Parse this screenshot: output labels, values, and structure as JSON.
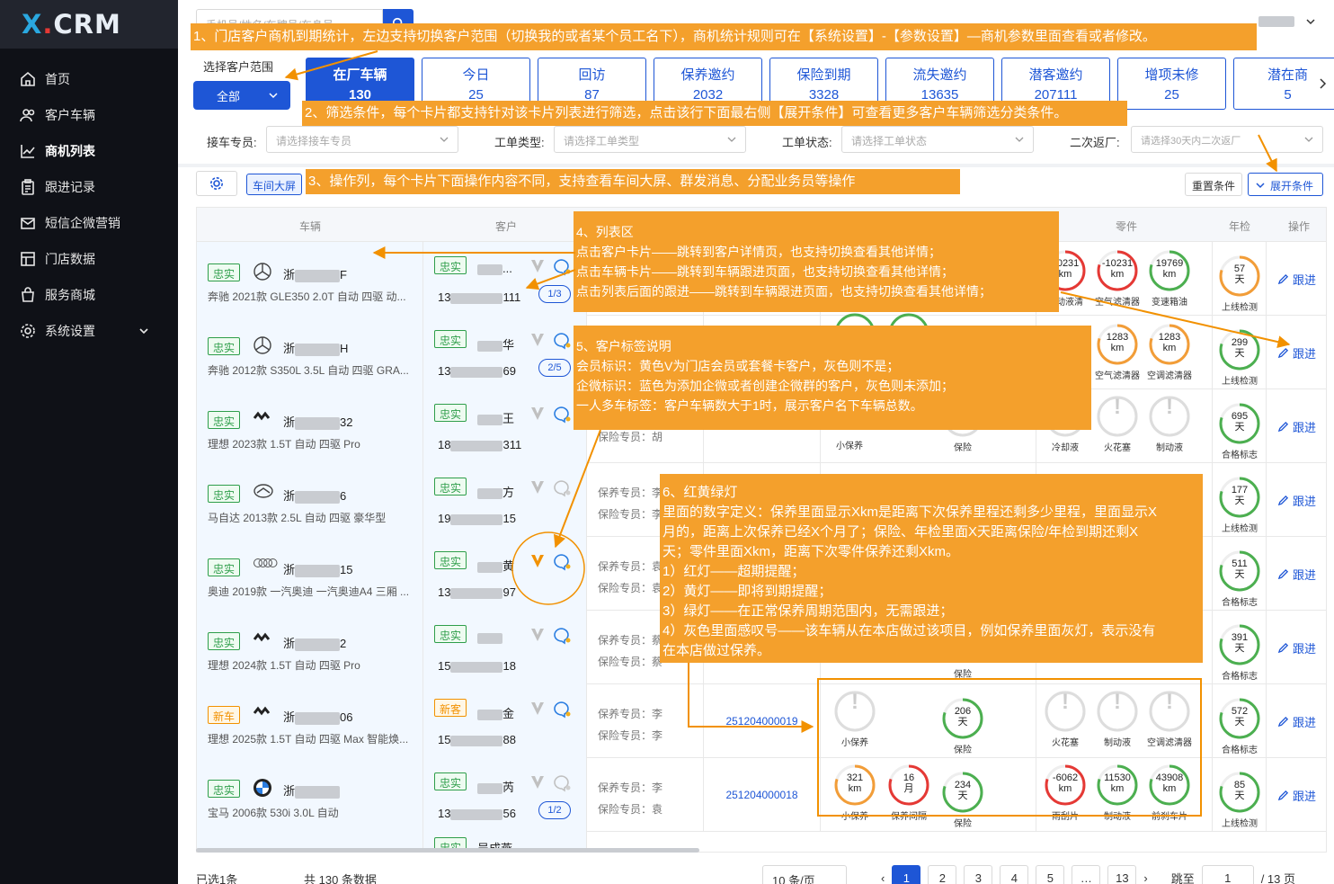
{
  "app": {
    "logo_x": "X",
    "logo_dot": ".",
    "logo_crm": "CRM"
  },
  "sidebar": {
    "items": [
      {
        "label": "首页",
        "icon": "home-icon",
        "active": false
      },
      {
        "label": "客户车辆",
        "icon": "users-icon",
        "active": false
      },
      {
        "label": "商机列表",
        "icon": "chart-line-icon",
        "active": true
      },
      {
        "label": "跟进记录",
        "icon": "clipboard-icon",
        "active": false
      },
      {
        "label": "短信企微营销",
        "icon": "mail-icon",
        "active": false
      },
      {
        "label": "门店数据",
        "icon": "data-board-icon",
        "active": false
      },
      {
        "label": "服务商城",
        "icon": "bag-icon",
        "active": false
      },
      {
        "label": "系统设置",
        "icon": "settings-icon",
        "active": false
      }
    ]
  },
  "topbar": {
    "search_placeholder": "手机号/姓名/车牌号/车身号"
  },
  "scope": {
    "label": "选择客户范围",
    "value": "全部"
  },
  "cards": [
    {
      "title": "在厂车辆",
      "count": "130",
      "active": true
    },
    {
      "title": "今日",
      "count": "25",
      "active": false
    },
    {
      "title": "回访",
      "count": "87",
      "active": false
    },
    {
      "title": "保养邀约",
      "count": "2032",
      "active": false
    },
    {
      "title": "保险到期",
      "count": "3328",
      "active": false
    },
    {
      "title": "流失邀约",
      "count": "13635",
      "active": false
    },
    {
      "title": "潜客邀约",
      "count": "207111",
      "active": false
    },
    {
      "title": "增项未修",
      "count": "25",
      "active": false
    },
    {
      "title": "潜在商",
      "count": "5",
      "active": false
    }
  ],
  "filters": {
    "reception": {
      "label": "接车专员:",
      "placeholder": "请选择接车专员"
    },
    "order_type": {
      "label": "工单类型:",
      "placeholder": "请选择工单类型"
    },
    "order_status": {
      "label": "工单状态:",
      "placeholder": "请选择工单状态"
    },
    "return": {
      "label": "二次返厂:",
      "placeholder": "请选择30天内二次返厂"
    }
  },
  "toolbar": {
    "workshop_screen": "车间大屏",
    "reset": "重置条件",
    "expand": "展开条件"
  },
  "table": {
    "headers": {
      "vehicle": "车辆",
      "customer": "客户",
      "parts": "零件",
      "annual": "年检",
      "op": "操作"
    },
    "rows": [
      {
        "tag": "忠实",
        "tag_color": "g",
        "brand": "benz-logo",
        "plate_prefix": "浙",
        "plate_suffix": "F",
        "model": "奔驰 2021款 GLE350 2.0T 自动 四驱 动...",
        "ctag": "忠实",
        "cname_suffix": "...",
        "phone_prefix": "13",
        "phone_suffix": "111",
        "vip": false,
        "wx": true,
        "count": "1/3",
        "annual_val": "57",
        "annual_unit": "天",
        "annual_label": "上线检测",
        "annual_color": "#f29d38",
        "follow": "跟进"
      },
      {
        "tag": "忠实",
        "tag_color": "g",
        "brand": "benz-logo",
        "plate_prefix": "浙",
        "plate_suffix": "H",
        "model": "奔驰 2012款 S350L 3.5L 自动 四驱 GRA...",
        "ctag": "忠实",
        "cname_suffix": "华",
        "phone_prefix": "13",
        "phone_suffix": "69",
        "vip": false,
        "wx": true,
        "count": "2/5",
        "annual_val": "299",
        "annual_unit": "天",
        "annual_label": "上线检测",
        "annual_color": "#4caf50",
        "follow": "跟进"
      },
      {
        "tag": "忠实",
        "tag_color": "g",
        "brand": "lixiang-logo",
        "plate_prefix": "浙",
        "plate_suffix": "32",
        "model": "理想 2023款 1.5T 自动 四驱 Pro",
        "ctag": "忠实",
        "cname_suffix": "王",
        "phone_prefix": "18",
        "phone_suffix": "311",
        "vip": false,
        "wx": true,
        "count": "",
        "annual_val": "695",
        "annual_unit": "天",
        "annual_label": "合格标志",
        "annual_color": "#4caf50",
        "follow": "跟进"
      },
      {
        "tag": "忠实",
        "tag_color": "g",
        "brand": "mazda-logo",
        "plate_prefix": "浙",
        "plate_suffix": "6",
        "model": "马自达 2013款 2.5L 自动 四驱 豪华型",
        "ctag": "忠实",
        "cname_suffix": "方",
        "phone_prefix": "19",
        "phone_suffix": "15",
        "vip": false,
        "wx": false,
        "count": "",
        "annual_val": "177",
        "annual_unit": "天",
        "annual_label": "上线检测",
        "annual_color": "#4caf50",
        "follow": "跟进"
      },
      {
        "tag": "忠实",
        "tag_color": "g",
        "brand": "audi-logo",
        "plate_prefix": "浙",
        "plate_suffix": "15",
        "model": "奥迪 2019款 一汽奥迪 一汽奥迪A4 三厢 ...",
        "ctag": "忠实",
        "cname_suffix": "黄",
        "phone_prefix": "13",
        "phone_suffix": "97",
        "vip": true,
        "wx": true,
        "count": "",
        "annual_val": "511",
        "annual_unit": "天",
        "annual_label": "合格标志",
        "annual_color": "#4caf50",
        "follow": "跟进"
      },
      {
        "tag": "忠实",
        "tag_color": "g",
        "brand": "lixiang-logo",
        "plate_prefix": "浙",
        "plate_suffix": "2",
        "model": "理想 2024款 1.5T 自动 四驱 Pro",
        "ctag": "忠实",
        "cname_suffix": "",
        "phone_prefix": "15",
        "phone_suffix": "18",
        "vip": false,
        "wx": true,
        "count": "",
        "annual_val": "391",
        "annual_unit": "天",
        "annual_label": "合格标志",
        "annual_color": "#4caf50",
        "follow": "跟进"
      },
      {
        "tag": "新车",
        "tag_color": "o",
        "brand": "lixiang-logo",
        "plate_prefix": "浙",
        "plate_suffix": "06",
        "model": "理想 2025款 1.5T 自动 四驱 Max 智能焕...",
        "ctag": "新客",
        "cname_suffix": "金",
        "phone_prefix": "15",
        "phone_suffix": "88",
        "vip": false,
        "wx": true,
        "count": "",
        "annual_val": "572",
        "annual_unit": "天",
        "annual_label": "合格标志",
        "annual_color": "#4caf50",
        "follow": "跟进"
      },
      {
        "tag": "忠实",
        "tag_color": "g",
        "brand": "bmw-logo",
        "plate_prefix": "浙",
        "plate_suffix": "",
        "model": "宝马 2006款 530i 3.0L 自动",
        "ctag": "忠实",
        "cname_suffix": "芮",
        "phone_prefix": "13",
        "phone_suffix": "56",
        "vip": false,
        "wx": false,
        "count": "1/2",
        "annual_val": "85",
        "annual_unit": "天",
        "annual_label": "上线检测",
        "annual_color": "#4caf50",
        "follow": "跟进"
      }
    ],
    "row1_parts": [
      {
        "val": "10231",
        "unit": "km",
        "label": "制动液清",
        "color": "#e53935"
      },
      {
        "val": "-10231",
        "unit": "km",
        "label": "空气滤清器",
        "color": "#e53935"
      },
      {
        "val": "19769",
        "unit": "km",
        "label": "变速箱油",
        "color": "#4caf50"
      }
    ],
    "row2_parts": [
      {
        "val": "1283",
        "unit": "km",
        "label": "空气滤清器",
        "color": "#f29d38"
      },
      {
        "val": "1283",
        "unit": "km",
        "label": "空调滤清器",
        "color": "#f29d38"
      }
    ],
    "row3": {
      "mnt_label": "小保养",
      "ins_label": "保险",
      "parts": [
        {
          "label": "冷却液"
        },
        {
          "label": "火花塞"
        },
        {
          "label": "制动液"
        }
      ]
    },
    "row3_emp": "保险专员：胡",
    "row4_emp": [
      "保养专员：李",
      "保险专员：李"
    ],
    "row5_emp": [
      "保养专员：袁",
      "保险专员：袁"
    ],
    "row6_emp": [
      "保养专员：蔡",
      "保险专员：蔡"
    ],
    "row6_ins_label": "保险",
    "row7": {
      "emp": [
        "保养专员：李",
        "保险专员：李"
      ],
      "order": "251204000019",
      "mnt_label": "小保养",
      "ins_val": "206",
      "ins_unit": "天",
      "ins_label": "保险",
      "parts": [
        {
          "label": "火花塞"
        },
        {
          "label": "制动液"
        },
        {
          "label": "空调滤清器"
        }
      ]
    },
    "row8": {
      "emp": [
        "保养专员：李",
        "保险专员：袁"
      ],
      "order": "251204000018",
      "mnt": [
        {
          "val": "321",
          "unit": "km",
          "label": "小保养",
          "color": "#f29d38"
        },
        {
          "val": "16",
          "unit": "月",
          "label": "保养间隔",
          "color": "#e53935"
        }
      ],
      "ins_val": "234",
      "ins_unit": "天",
      "ins_label": "保险",
      "parts": [
        {
          "val": "-6062",
          "unit": "km",
          "label": "雨刮片",
          "color": "#e53935"
        },
        {
          "val": "11530",
          "unit": "km",
          "label": "制动液",
          "color": "#4caf50"
        },
        {
          "val": "43908",
          "unit": "km",
          "label": "前刹车片",
          "color": "#4caf50"
        }
      ]
    },
    "row9_tag": "忠实",
    "row9_cname": "吴成燕"
  },
  "footer": {
    "selected": "已选1条",
    "total": "共 130 条数据",
    "page_size": "10 条/页",
    "pages": [
      "1",
      "2",
      "3",
      "4",
      "5",
      "…",
      "13"
    ],
    "jump_label": "跳至",
    "jump_value": "1",
    "page_total": "/ 13 页"
  },
  "annotations": {
    "a1": "1、门店客户商机到期统计，左边支持切换客户范围（切换我的或者某个员工名下），商机统计规则可在【系统设置】-【参数设置】—商机参数里面查看或者修改。",
    "a2": "2、筛选条件，每个卡片都支持针对该卡片列表进行筛选，点击该行下面最右侧【展开条件】可查看更多客户车辆筛选分类条件。",
    "a3": "3、操作列，每个卡片下面操作内容不同，支持查看车间大屏、群发消息、分配业务员等操作",
    "a4": [
      "4、列表区",
      "点击客户卡片——跳转到客户详情页，也支持切换查看其他详情；",
      "点击车辆卡片——跳转到车辆跟进页面，也支持切换查看其他详情；",
      "点击列表后面的跟进——跳转到车辆跟进页面，也支持切换查看其他详情；"
    ],
    "a5": [
      "5、客户标签说明",
      "会员标识：黄色V为门店会员或套餐卡客户，灰色则不是；",
      "企微标识：蓝色为添加企微或者创建企微群的客户，灰色则未添加；",
      "一人多车标签：客户车辆数大于1时，展示客户名下车辆总数。"
    ],
    "a6": [
      "6、红黄绿灯",
      "里面的数字定义：保养里面显示Xkm是距离下次保养里程还剩多少里程，里面显示X",
      "月的，距离上次保养已经X个月了；保险、年检里面X天距离保险/年检到期还剩X",
      "天；零件里面Xkm，距离下次零件保养还剩Xkm。",
      "1）红灯——超期提醒；",
      "2）黄灯——即将到期提醒；",
      "3）绿灯——在正常保养周期范围内，无需跟进；",
      "4）灰色里面感叹号——该车辆从在本店做过该项目，例如保养里面灰灯，表示没有",
      "在本店做过保养。"
    ]
  }
}
